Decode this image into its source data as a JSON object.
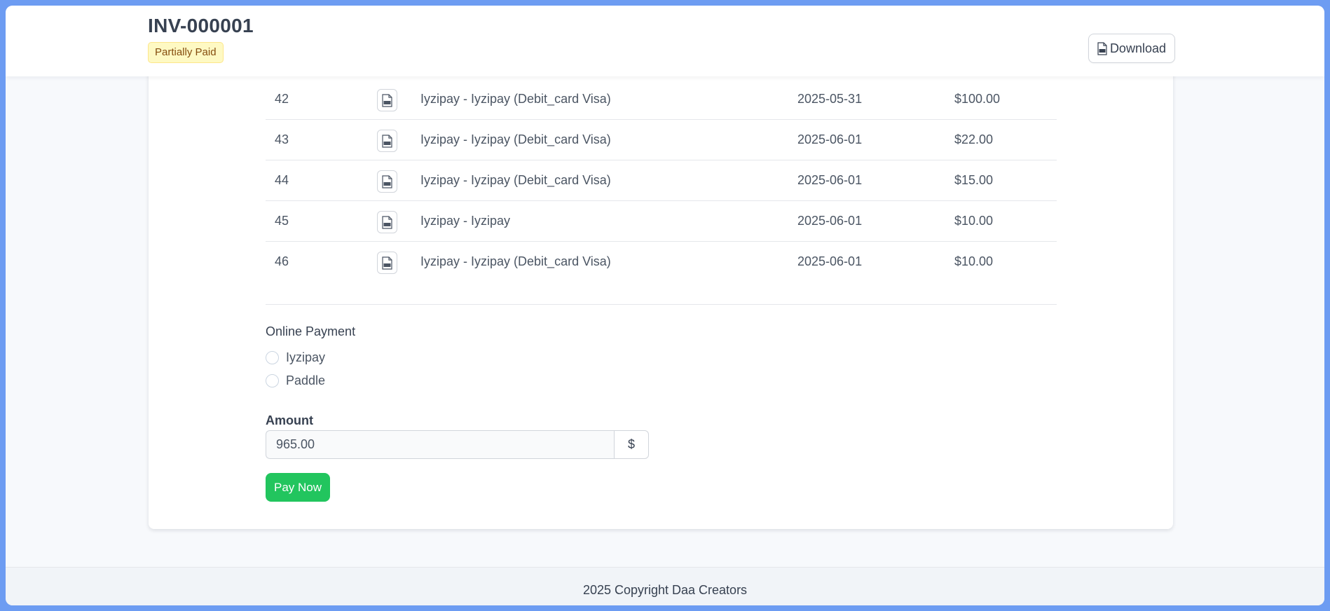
{
  "header": {
    "invoice_number": "INV-000001",
    "status_label": "Partially Paid",
    "download_label": "Download"
  },
  "payments": [
    {
      "id": "42",
      "description": "Iyzipay - Iyzipay (Debit_card Visa)",
      "date": "2025-05-31",
      "amount": "$100.00"
    },
    {
      "id": "43",
      "description": "Iyzipay - Iyzipay (Debit_card Visa)",
      "date": "2025-06-01",
      "amount": "$22.00"
    },
    {
      "id": "44",
      "description": "Iyzipay - Iyzipay (Debit_card Visa)",
      "date": "2025-06-01",
      "amount": "$15.00"
    },
    {
      "id": "45",
      "description": "Iyzipay - Iyzipay",
      "date": "2025-06-01",
      "amount": "$10.00"
    },
    {
      "id": "46",
      "description": "Iyzipay - Iyzipay (Debit_card Visa)",
      "date": "2025-06-01",
      "amount": "$10.00"
    }
  ],
  "online_payment": {
    "title": "Online Payment",
    "options": [
      "Iyzipay",
      "Paddle"
    ]
  },
  "amount": {
    "label": "Amount",
    "value": "965.00",
    "currency": "$"
  },
  "pay_button_label": "Pay Now",
  "footer": {
    "text": "2025 Copyright Daa Creators"
  },
  "colors": {
    "accent_green": "#22c55e",
    "badge_bg": "#fef9c3",
    "badge_text": "#854d0e",
    "frame_border": "#6d9cf2"
  }
}
